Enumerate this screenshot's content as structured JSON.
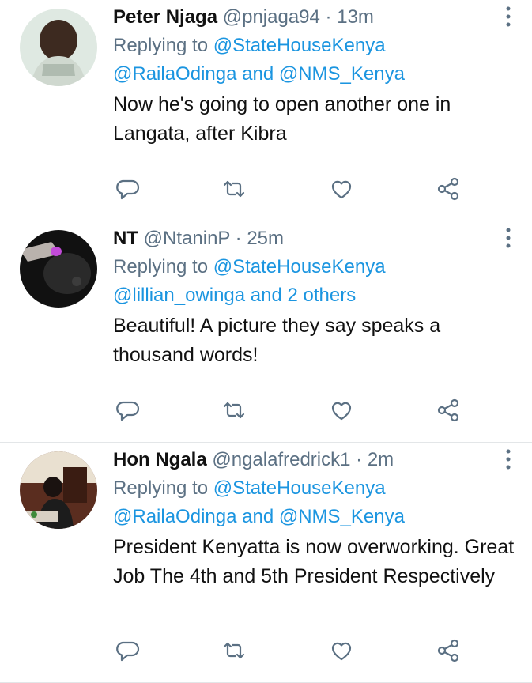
{
  "tweets": [
    {
      "name": "Peter Njaga",
      "handle": "@pnjaga94",
      "separator": "·",
      "time": "13m",
      "replying_prefix": "Replying to ",
      "reply_line1": "@StateHouseKenya",
      "reply_line2_a": "@RailaOdinga",
      "reply_and": " and ",
      "reply_line2_b": "@NMS_Kenya",
      "text": "Now he's going to open another one in Langata, after Kibra",
      "avatar_colors": {
        "bg": "#dfe9e2",
        "fg": "#3d2a20"
      }
    },
    {
      "name": "NT",
      "handle": "@NtaninP",
      "separator": "·",
      "time": "25m",
      "replying_prefix": "Replying to ",
      "reply_line1": "@StateHouseKenya",
      "reply_line2_a": "@lillian_owinga",
      "reply_and": " and ",
      "reply_line2_b": "2 others",
      "text": "Beautiful! A picture they say speaks a thousand words!",
      "avatar_colors": {
        "bg": "#111111",
        "fg": "#c24bd8"
      }
    },
    {
      "name": "Hon Ngala",
      "handle": "@ngalafredrick1",
      "separator": "·",
      "time": "2m",
      "replying_prefix": "Replying to ",
      "reply_line1": "@StateHouseKenya",
      "reply_line2_a": "@RailaOdinga",
      "reply_and": " and ",
      "reply_line2_b": "@NMS_Kenya",
      "text": "President Kenyatta is now overworking. Great Job The 4th and 5th President Respectively",
      "avatar_colors": {
        "bg": "#5a2d1f",
        "fg": "#e9e0d0"
      }
    }
  ],
  "icons": [
    "reply-icon",
    "retweet-icon",
    "like-icon",
    "share-icon",
    "more-options-icon"
  ],
  "colors": {
    "secondary": "#5b7083",
    "link": "#1b95e0",
    "divider": "#e3e6e8"
  }
}
